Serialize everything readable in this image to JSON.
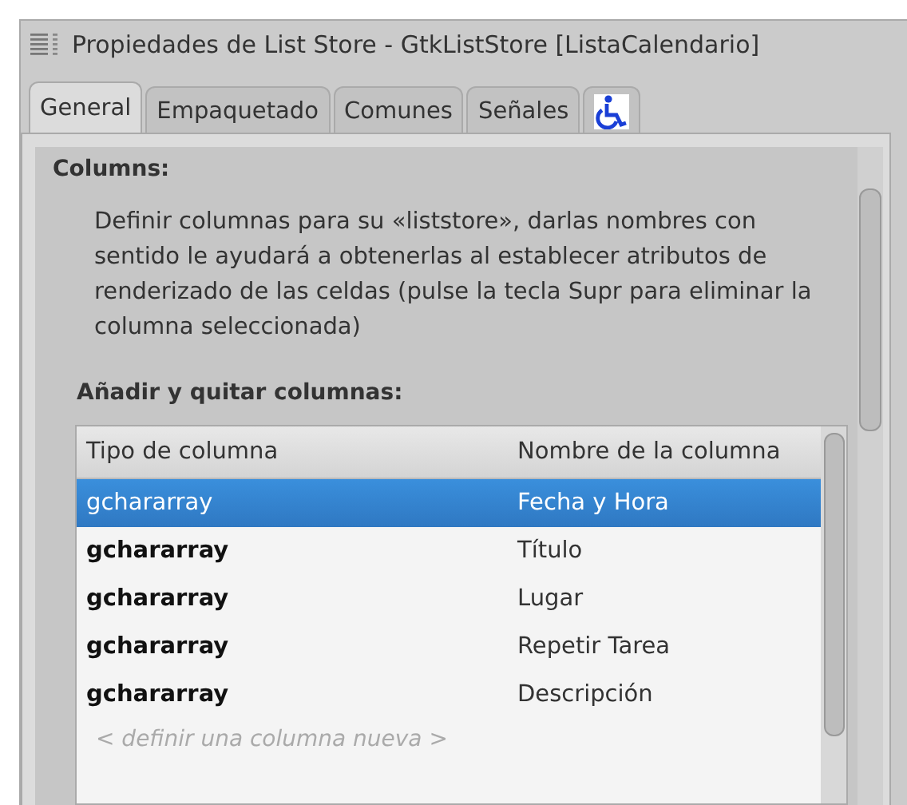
{
  "window": {
    "title": "Propiedades de List Store - GtkListStore [ListaCalendario]"
  },
  "tabs": [
    {
      "kind": "text",
      "label": "General",
      "selected": true
    },
    {
      "kind": "text",
      "label": "Empaquetado",
      "selected": false
    },
    {
      "kind": "text",
      "label": "Comunes",
      "selected": false
    },
    {
      "kind": "text",
      "label": "Señales",
      "selected": false
    },
    {
      "kind": "accessibility",
      "selected": false
    }
  ],
  "section": {
    "title": "Columns:",
    "description": "Definir columnas para su «liststore», darlas nombres con sentido le ayudará a obtenerlas al establecer atributos de renderizado de las celdas (pulse la tecla Supr para eliminar la columna seleccionada)",
    "subtitle": "Añadir y quitar columnas:"
  },
  "table": {
    "columns": [
      "Tipo de columna",
      "Nombre de la columna"
    ],
    "rows": [
      {
        "type": "gchararray",
        "name": "Fecha y Hora",
        "selected": true
      },
      {
        "type": "gchararray",
        "name": "Título",
        "selected": false
      },
      {
        "type": "gchararray",
        "name": "Lugar",
        "selected": false
      },
      {
        "type": "gchararray",
        "name": "Repetir Tarea",
        "selected": false
      },
      {
        "type": "gchararray",
        "name": "Descripción",
        "selected": false
      }
    ],
    "placeholder": "< definir una columna nueva >"
  }
}
